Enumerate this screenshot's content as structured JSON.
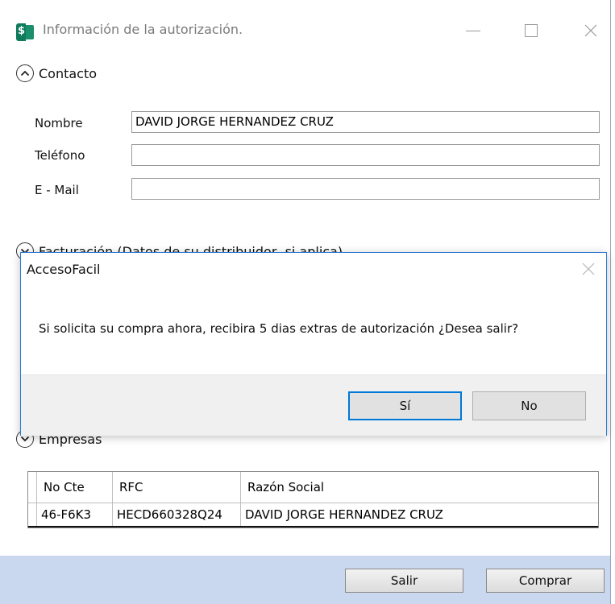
{
  "window": {
    "title": "Información de la autorización.",
    "minimize_glyph": "",
    "close_glyph": "✕"
  },
  "contacto": {
    "section_label": "Contacto",
    "nombre_label": "Nombre",
    "nombre_value": "DAVID JORGE HERNANDEZ CRUZ",
    "telefono_label": "Teléfono",
    "telefono_value": "",
    "email_label": "E - Mail",
    "email_value": ""
  },
  "facturacion": {
    "section_label_partial": "Facturación (Datos de su distribuidor, si aplica)"
  },
  "empresas": {
    "section_label": "Empresas",
    "columns": [
      "No Cte",
      "RFC",
      "Razón Social"
    ],
    "rows": [
      [
        "46-F6K3",
        "HECD660328Q24",
        "DAVID JORGE HERNANDEZ CRUZ"
      ]
    ]
  },
  "footer": {
    "salir_label": "Salir",
    "comprar_label": "Comprar"
  },
  "dialog": {
    "title": "AccesoFacil",
    "message": "Si solicita su compra ahora, recibira 5 dias extras de autorización ¿Desea salir?",
    "yes_label": "Sí",
    "no_label": "No"
  },
  "colors": {
    "footer_bg": "#c9d8ee",
    "dialog_border": "#2b79d4",
    "default_button_border": "#0078d7",
    "app_icon": "#0f7b5a"
  },
  "icons": [
    "app-icon",
    "minimize-icon",
    "maximize-icon",
    "close-icon",
    "collapse-chevron-up-icon",
    "expand-chevron-down-icon",
    "dialog-close-icon"
  ]
}
